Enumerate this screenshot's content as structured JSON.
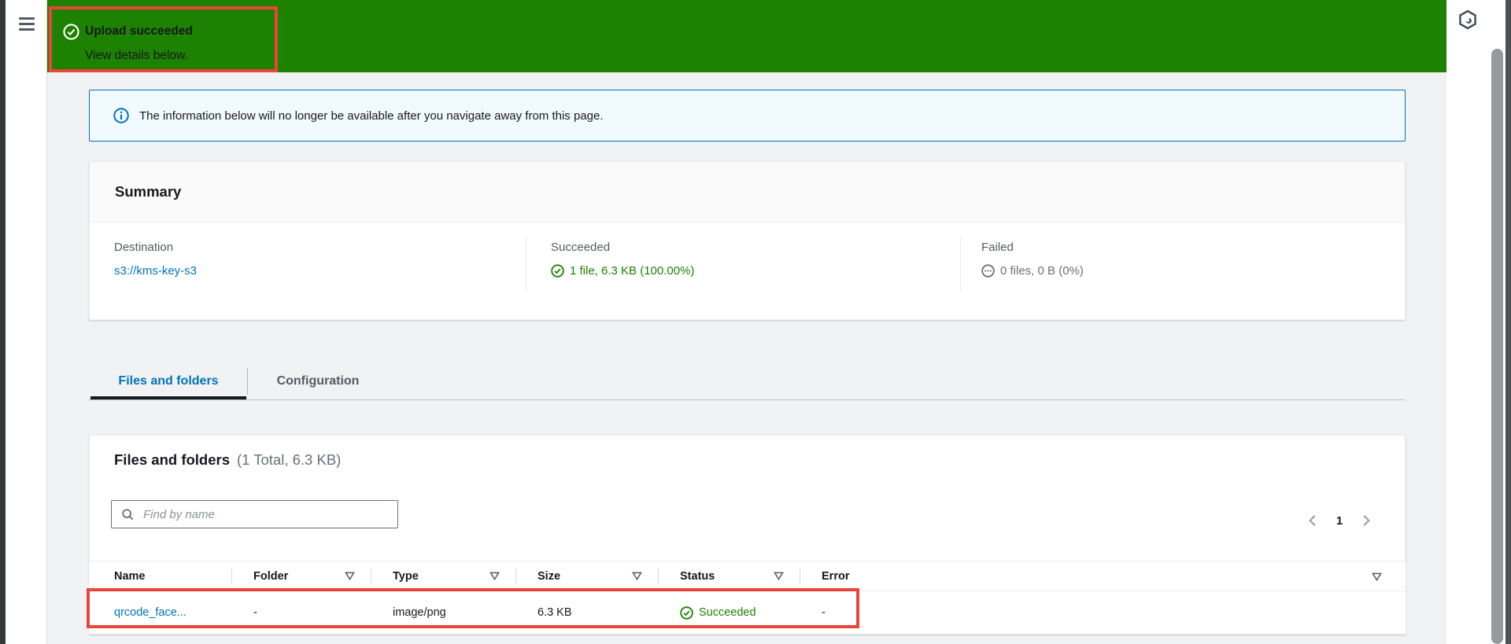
{
  "chrome": {
    "hamburger_icon": "hamburger-menu-icon",
    "cloudshell_icon": "cloudshell-hexagon-icon",
    "scrollbar": "vertical-scrollbar"
  },
  "banner": {
    "icon": "check-circle-icon",
    "title": "Upload succeeded",
    "subtitle": "View details below."
  },
  "alert": {
    "icon": "info-circle-icon",
    "text": "The information below will no longer be available after you navigate away from this page."
  },
  "summary": {
    "title": "Summary",
    "destination": {
      "label": "Destination",
      "value": "s3://kms-key-s3"
    },
    "succeeded": {
      "label": "Succeeded",
      "icon": "check-circle-icon",
      "value": "1 file, 6.3 KB (100.00%)"
    },
    "failed": {
      "label": "Failed",
      "icon": "ellipsis-circle-icon",
      "value": "0 files, 0 B (0%)"
    }
  },
  "tabs": [
    {
      "label": "Files and folders",
      "active": true
    },
    {
      "label": "Configuration",
      "active": false
    }
  ],
  "files_panel": {
    "title": "Files and folders",
    "count": "(1 Total, 6.3 KB)",
    "search": {
      "icon": "search-icon",
      "placeholder": "Find by name"
    },
    "pagination": {
      "prev_icon": "chevron-left-icon",
      "page": "1",
      "next_icon": "chevron-right-icon"
    },
    "table": {
      "columns": [
        {
          "label": "Name",
          "filter": false
        },
        {
          "label": "Folder",
          "filter": true
        },
        {
          "label": "Type",
          "filter": true
        },
        {
          "label": "Size",
          "filter": true
        },
        {
          "label": "Status",
          "filter": true
        },
        {
          "label": "Error",
          "filter": true
        }
      ],
      "row": {
        "name": "qrcode_face...",
        "folder": "-",
        "type": "image/png",
        "size": "6.3 KB",
        "status": "Succeeded",
        "status_icon": "check-circle-icon",
        "error": "-"
      }
    }
  },
  "colors": {
    "banner_green": "#1d8102",
    "success_green": "#1d8102",
    "accent_blue": "#0073bb",
    "alert_bg": "#f1faff",
    "annotation_red": "#e8463a"
  }
}
